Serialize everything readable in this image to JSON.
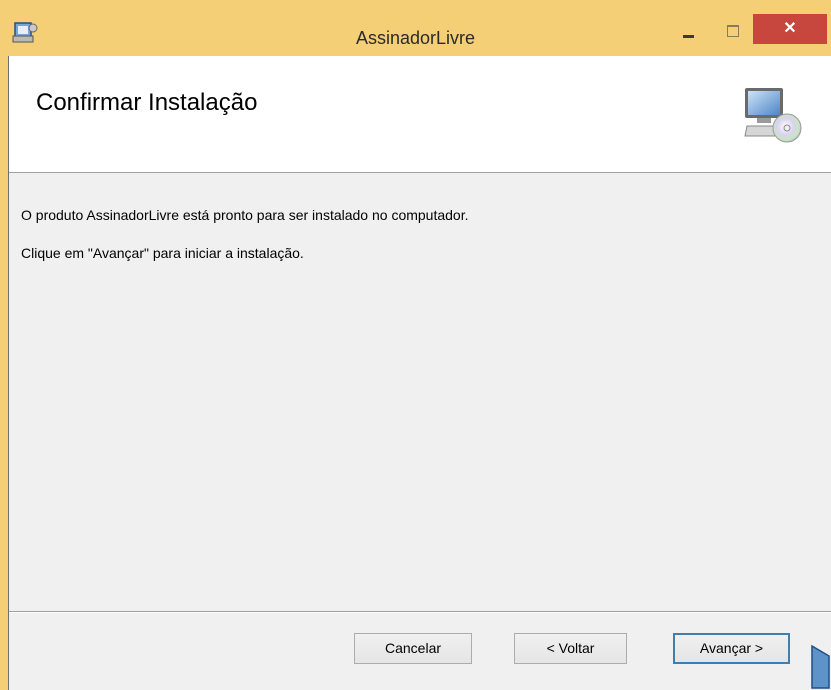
{
  "window": {
    "title": "AssinadorLivre",
    "close_glyph": "✕"
  },
  "banner": {
    "title": "Confirmar Instalação",
    "icon": "computer-cd-icon"
  },
  "body": {
    "line1": "O produto AssinadorLivre está pronto para ser instalado no computador.",
    "line2": "Clique em \"Avançar\" para iniciar a instalação."
  },
  "buttons": {
    "cancel": "Cancelar",
    "back": "< Voltar",
    "next": "Avançar >"
  },
  "colors": {
    "frame": "#f4cf76",
    "close": "#c7473f",
    "focus": "#3c7fb1"
  }
}
